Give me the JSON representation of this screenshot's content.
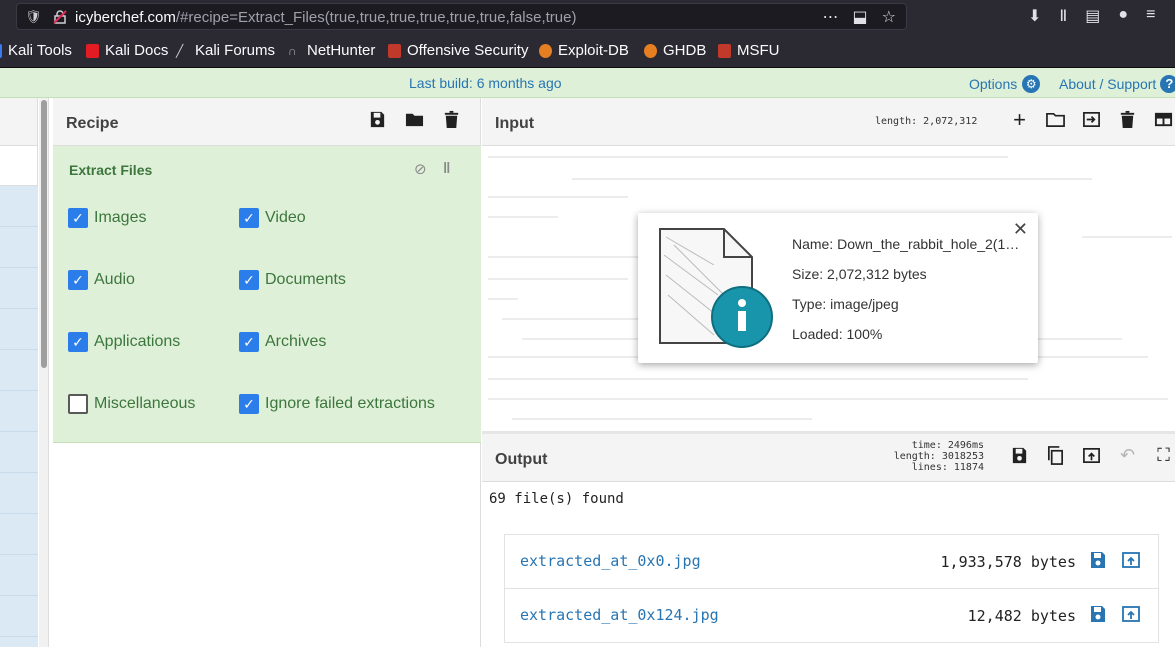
{
  "browser": {
    "url_host": "icyberchef.com",
    "url_path": "/#recipe=Extract_Files(true,true,true,true,true,true,false,true)",
    "bookmarks": [
      {
        "label": "Kali Tools",
        "color": "#367bf0"
      },
      {
        "label": "Kali Docs",
        "color": "#e31b23"
      },
      {
        "label": "Kali Forums",
        "color": "#cccccc"
      },
      {
        "label": "NetHunter",
        "color": "#888888"
      },
      {
        "label": "Offensive Security",
        "color": "#c0392b"
      },
      {
        "label": "Exploit-DB",
        "color": "#e67e22"
      },
      {
        "label": "GHDB",
        "color": "#e67e22"
      },
      {
        "label": "MSFU",
        "color": "#c0392b"
      }
    ]
  },
  "banner": {
    "last_build": "Last build: 6 months ago",
    "options": "Options",
    "about": "About / Support"
  },
  "recipe": {
    "title": "Recipe",
    "operation": {
      "name": "Extract Files",
      "checkboxes": [
        {
          "label": "Images",
          "checked": true
        },
        {
          "label": "Video",
          "checked": true
        },
        {
          "label": "Audio",
          "checked": true
        },
        {
          "label": "Documents",
          "checked": true
        },
        {
          "label": "Applications",
          "checked": true
        },
        {
          "label": "Archives",
          "checked": true
        },
        {
          "label": "Miscellaneous",
          "checked": false
        },
        {
          "label": "Ignore failed extractions",
          "checked": true
        }
      ]
    }
  },
  "input": {
    "title": "Input",
    "length": "length: 2,072,312",
    "file_info": {
      "name": "Name: Down_the_rabbit_hole_2(1…",
      "size": "Size: 2,072,312 bytes",
      "type": "Type: image/jpeg",
      "loaded": "Loaded: 100%"
    }
  },
  "output": {
    "title": "Output",
    "time": "time:  2496ms",
    "length": "length: 3018253",
    "lines": "lines:   11874",
    "found": "69 file(s) found",
    "files": [
      {
        "name": "extracted_at_0x0.jpg",
        "size": "1,933,578 bytes"
      },
      {
        "name": "extracted_at_0x124.jpg",
        "size": "12,482 bytes"
      }
    ]
  },
  "colors": {
    "accent": "#2775b3",
    "op_green_bg": "#dff0d8",
    "op_green_text": "#3c763d",
    "checkbox": "#2b7de9"
  }
}
